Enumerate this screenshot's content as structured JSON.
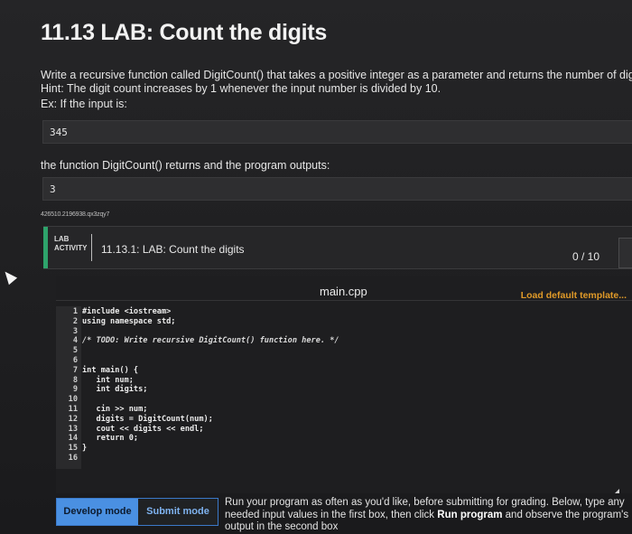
{
  "title": "11.13 LAB: Count the digits",
  "description_line1": "Write a recursive function called DigitCount() that takes a positive integer as a parameter and returns the number of digits in the integ",
  "description_line2": "Hint: The digit count increases by 1 whenever the input number is divided by 10.",
  "example_label": "Ex: If the input is:",
  "example_input": "345",
  "output_label": "the function DigitCount() returns and the program outputs:",
  "example_output": "3",
  "session_id": "426510.2196938.qx3zqy7",
  "lab": {
    "tag_line1": "LAB",
    "tag_line2": "ACTIVITY",
    "title": "11.13.1: LAB: Count the digits",
    "score": "0 / 10",
    "accent_color": "#2ea36b"
  },
  "editor": {
    "file_name": "main.cpp",
    "load_template_label": "Load default template...",
    "lines": [
      {
        "n": "1",
        "code": "#include <iostream>"
      },
      {
        "n": "2",
        "code": "using namespace std;"
      },
      {
        "n": "3",
        "code": ""
      },
      {
        "n": "4",
        "code": "/* TODO: Write recursive DigitCount() function here. */"
      },
      {
        "n": "5",
        "code": ""
      },
      {
        "n": "6",
        "code": ""
      },
      {
        "n": "7",
        "code": "int main() {"
      },
      {
        "n": "8",
        "code": "   int num;"
      },
      {
        "n": "9",
        "code": "   int digits;"
      },
      {
        "n": "10",
        "code": ""
      },
      {
        "n": "11",
        "code": "   cin >> num;"
      },
      {
        "n": "12",
        "code": "   digits = DigitCount(num);"
      },
      {
        "n": "13",
        "code": "   cout << digits << endl;"
      },
      {
        "n": "14",
        "code": "   return 0;"
      },
      {
        "n": "15",
        "code": "}"
      },
      {
        "n": "16",
        "code": ""
      }
    ]
  },
  "modes": {
    "develop_label": "Develop mode",
    "submit_label": "Submit mode",
    "accent_color": "#4a90e2"
  },
  "run_text": {
    "part1": "Run your program as often as you'd like, before submitting for grading. Below, type any needed input values in the first box, then click ",
    "bold": "Run program",
    "part2": " and observe the program's output in the second box"
  }
}
